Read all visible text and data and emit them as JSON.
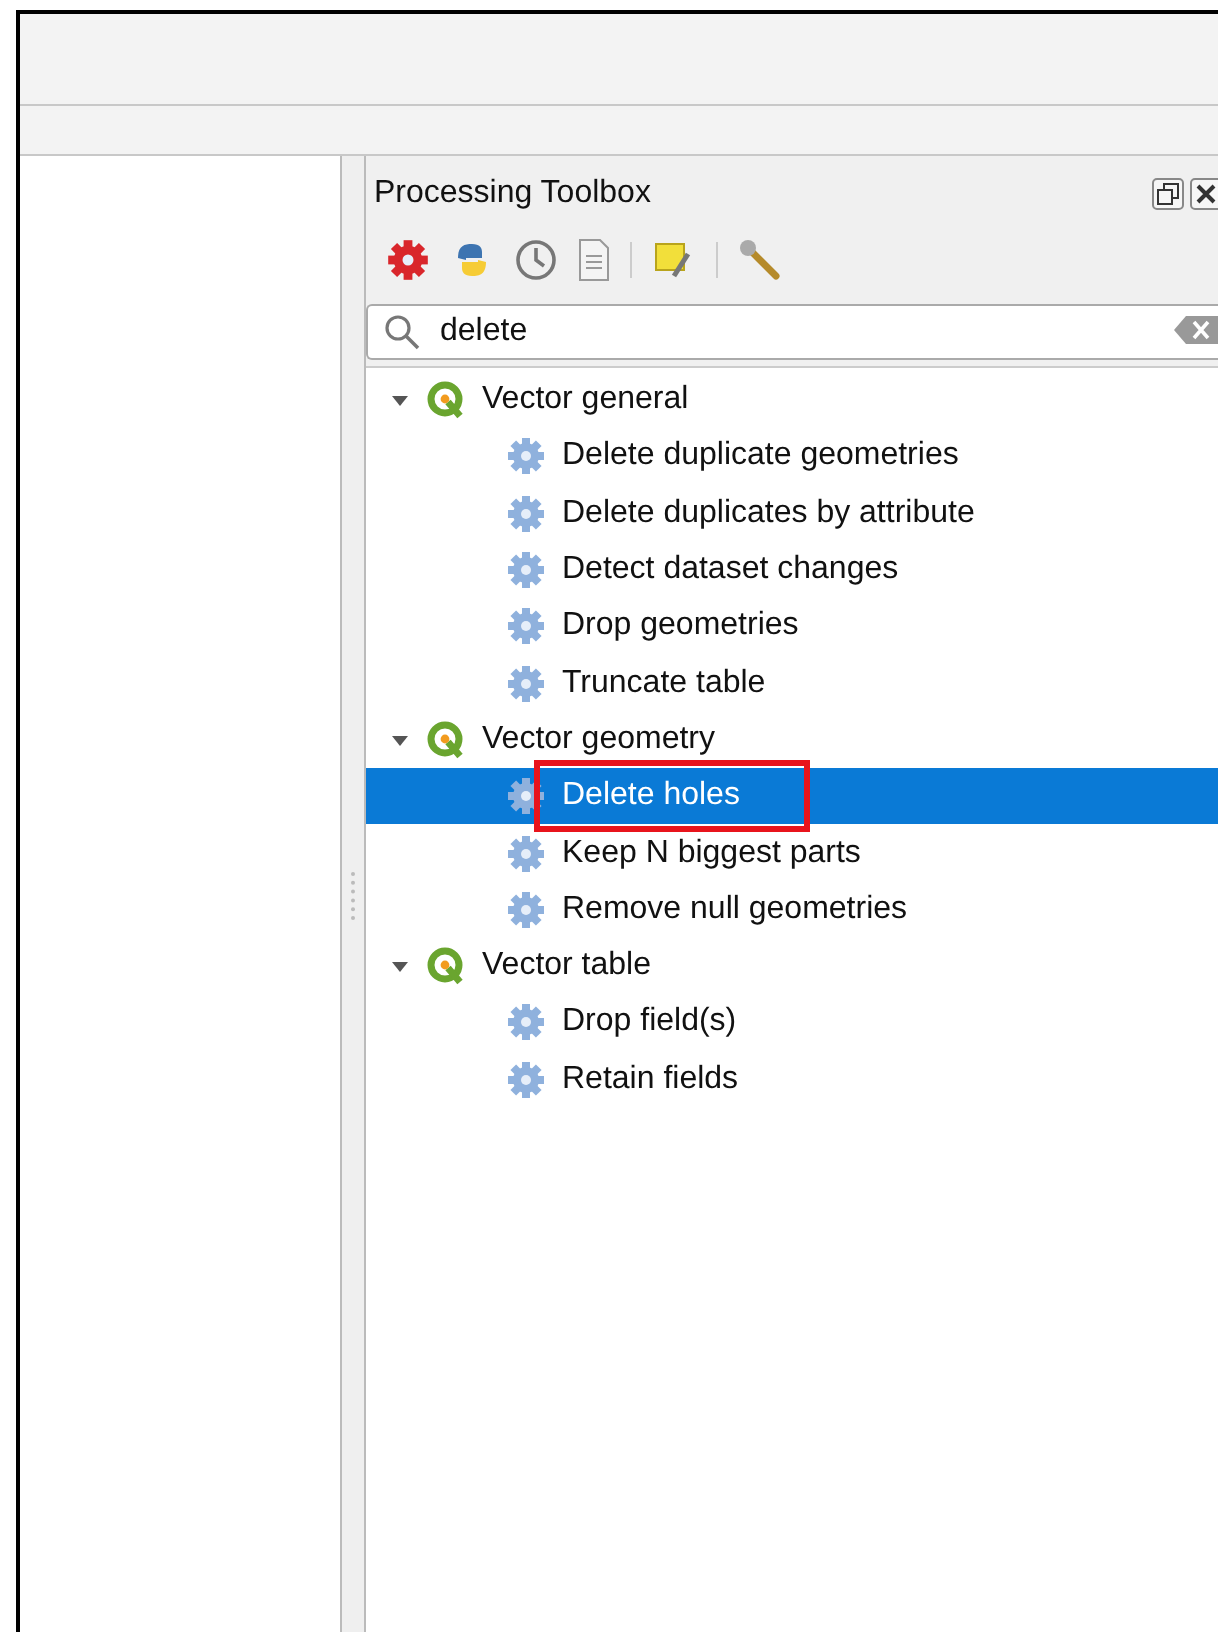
{
  "panel": {
    "title": "Processing Toolbox"
  },
  "search": {
    "value": "delete"
  },
  "tree": [
    {
      "label": "Vector general",
      "expanded": true,
      "children": [
        {
          "label": "Delete duplicate geometries",
          "selected": false,
          "annotated": false
        },
        {
          "label": "Delete duplicates by attribute",
          "selected": false,
          "annotated": false
        },
        {
          "label": "Detect dataset changes",
          "selected": false,
          "annotated": false
        },
        {
          "label": "Drop geometries",
          "selected": false,
          "annotated": false
        },
        {
          "label": "Truncate table",
          "selected": false,
          "annotated": false
        }
      ]
    },
    {
      "label": "Vector geometry",
      "expanded": true,
      "children": [
        {
          "label": "Delete holes",
          "selected": true,
          "annotated": true
        },
        {
          "label": "Keep N biggest parts",
          "selected": false,
          "annotated": false
        },
        {
          "label": "Remove null geometries",
          "selected": false,
          "annotated": false
        }
      ]
    },
    {
      "label": "Vector table",
      "expanded": true,
      "children": [
        {
          "label": "Drop field(s)",
          "selected": false,
          "annotated": false
        },
        {
          "label": "Retain fields",
          "selected": false,
          "annotated": false
        }
      ]
    }
  ]
}
